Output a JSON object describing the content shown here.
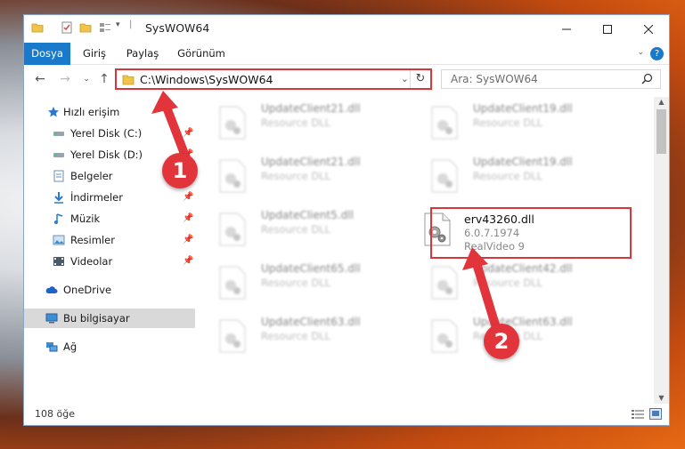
{
  "window": {
    "title": "SysWOW64"
  },
  "ribbon": {
    "tabs": [
      "Dosya",
      "Giriş",
      "Paylaş",
      "Görünüm"
    ],
    "help": "?"
  },
  "address": {
    "path": "C:\\Windows\\SysWOW64"
  },
  "search": {
    "placeholder": "Ara: SysWOW64"
  },
  "sidebar": {
    "items": [
      {
        "label": "Hızlı erişim",
        "icon": "star-icon"
      },
      {
        "label": "Yerel Disk (C:)",
        "icon": "drive-icon"
      },
      {
        "label": "Yerel Disk (D:)",
        "icon": "drive-icon"
      },
      {
        "label": "Belgeler",
        "icon": "document-icon"
      },
      {
        "label": "İndirmeler",
        "icon": "download-icon"
      },
      {
        "label": "Müzik",
        "icon": "music-icon"
      },
      {
        "label": "Resimler",
        "icon": "pictures-icon"
      },
      {
        "label": "Videolar",
        "icon": "video-icon"
      },
      {
        "label": "OneDrive",
        "icon": "cloud-icon"
      },
      {
        "label": "Bu bilgisayar",
        "icon": "computer-icon"
      },
      {
        "label": "Ağ",
        "icon": "network-icon"
      }
    ]
  },
  "files": [
    {
      "name": "UpdateClient21.dll",
      "sub": "Resource DLL"
    },
    {
      "name": "UpdateClient19.dll",
      "sub": "Resource DLL"
    },
    {
      "name": "UpdateClient21.dll",
      "sub": "Resource DLL"
    },
    {
      "name": "UpdateClient19.dll",
      "sub": "Resource DLL"
    },
    {
      "name": "UpdateClient5.dll",
      "sub": "Resource DLL"
    },
    {
      "name": "erv43260.dll",
      "sub": "6.0.7.1974",
      "sub2": "RealVideo 9"
    },
    {
      "name": "UpdateClient65.dll",
      "sub": "Resource DLL"
    },
    {
      "name": "UpdateClient42.dll",
      "sub": "Resource DLL"
    },
    {
      "name": "UpdateClient63.dll",
      "sub": "Resource DLL"
    },
    {
      "name": "UpdateClient63.dll",
      "sub": "Resource DLL"
    }
  ],
  "status": {
    "count": "108 öğe"
  },
  "annotations": {
    "step1": "1",
    "step2": "2",
    "highlight_color": "#d8363b"
  }
}
